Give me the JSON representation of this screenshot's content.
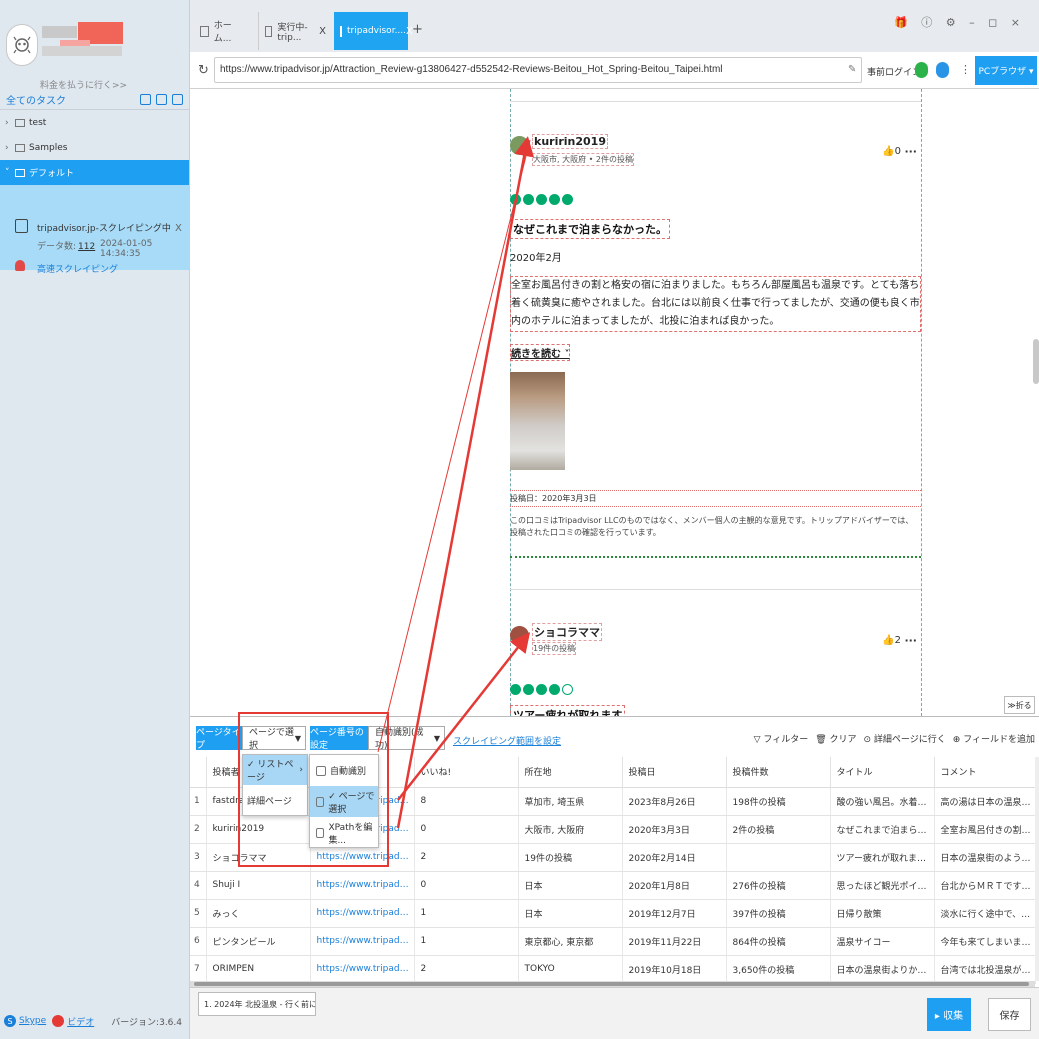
{
  "sidebar": {
    "pay_link": "料金を払うに行く>>",
    "tasks_header": "全てのタスク",
    "folders": [
      {
        "label": "test",
        "chev": "›"
      },
      {
        "label": "Samples",
        "chev": "›"
      },
      {
        "label": "デフォルト",
        "chev": "˅"
      }
    ],
    "task": {
      "name": "tripadvisor.jp-スクレイピング中",
      "close": "X",
      "count_label": "データ数:",
      "count": "112",
      "time": "2024-01-05 14:34:35",
      "mode": "高速スクレイピング"
    },
    "footer": {
      "skype": "Skype",
      "video": "ビデオ",
      "version": "バージョン:3.6.4"
    }
  },
  "tabs": [
    {
      "label": "ホーム...",
      "close": ""
    },
    {
      "label": "実行中-trip...",
      "close": "X"
    },
    {
      "label": "tripadvisor....",
      "close": "X"
    }
  ],
  "window_controls": "🎁 ⓘ ⚙ – ◻ ×",
  "address": {
    "url": "https://www.tripadvisor.jp/Attraction_Review-g13806427-d552542-Reviews-Beitou_Hot_Spring-Beitou_Taipei.html",
    "login": "事前ログイン",
    "mode_button": "PCブラウザ ▾"
  },
  "reviews": [
    {
      "name": "kuririn2019",
      "location": "大阪市, 大阪府 • 2件の投稿",
      "likes": "0",
      "rating": 5,
      "title": "なぜこれまで泊まらなかった。",
      "date": "2020年2月",
      "body": "全室お風呂付きの割と格安の宿に泊まりました。もちろん部屋風呂も温泉です。とても落ち着く硫黄臭に癒やされました。台北には以前良く仕事で行ってましたが、交通の便も良く市内のホテルに泊まってましたが、北投に泊まれば良かった。",
      "read_more": "続きを読む",
      "posted": "投稿日：2020年3月3日",
      "disclaimer": "この口コミはTripadvisor LLCのものではなく、メンバー個人の主観的な意見です。トリップアドバイザーでは、投稿された口コミの確認を行っています。"
    },
    {
      "name": "ショコラママ",
      "location": "19件の投稿",
      "likes": "2",
      "rating": 4,
      "title": "ツアー疲れが取れます"
    }
  ],
  "collapse_label": "≫折る",
  "panel": {
    "page_type_btn": "ページタイプ",
    "page_type_value": "ページで選択",
    "page_num_btn": "ページ番号の設定",
    "page_num_value": "自動識別(成功)",
    "scope_link": "スクレイピング範囲を設定",
    "actions": [
      "▽ フィルター",
      "🗑 クリア",
      "⊙ 詳細ページに行く",
      "⊕ フィールドを追加"
    ],
    "dropdown1": [
      {
        "label": "✓ リストページ",
        "sub": "›"
      },
      {
        "label": "詳細ページ",
        "sub": ""
      }
    ],
    "dropdown2": [
      "自動識別",
      "✓ ページで選択",
      "XPathを編集..."
    ],
    "columns": [
      "",
      "投稿者",
      "",
      "いいね!",
      "所在地",
      "投稿日",
      "投稿件数",
      "タイトル",
      "コメント"
    ],
    "rows": [
      [
        "1",
        "fastdravich",
        "https://www.tripadvisor.jp/Profil...",
        "8",
        "草加市, 埼玉県",
        "2023年8月26日",
        "198件の投稿",
        "酸の強い風呂。水着に注意。",
        "高の湯は日本の温泉地にある公..."
      ],
      [
        "2",
        "kuririn2019",
        "https://www.tripadvisor.jp/Profil...",
        "0",
        "大阪市, 大阪府",
        "2020年3月3日",
        "2件の投稿",
        "なぜこれまで泊まらなかった。",
        "全室お風呂付きの割と格安の宿..."
      ],
      [
        "3",
        "ショコラママ",
        "https://www.tripadvisor.jp/Profil...",
        "2",
        "19件の投稿",
        "2020年2月14日",
        "",
        "ツアー疲れが取れます。",
        "日本の温泉街のように、丘に沿..."
      ],
      [
        "4",
        "Shuji I",
        "https://www.tripadvisor.jp/Profil...",
        "0",
        "日本",
        "2020年1月8日",
        "276件の投稿",
        "思ったほど観光ポイントは少ない",
        "台北からＭＲＴですぐにこれる..."
      ],
      [
        "5",
        "みっく",
        "https://www.tripadvisor.jp/Profil...",
        "1",
        "日本",
        "2019年12月7日",
        "397件の投稿",
        "日帰り散策",
        "淡水に行く途中で、日帰り散策..."
      ],
      [
        "6",
        "ピンタンビール",
        "https://www.tripadvisor.jp/Profil...",
        "1",
        "東京都心, 東京都",
        "2019年11月22日",
        "864件の投稿",
        "温泉サイコー",
        "今年も来てしまいました。ここ..."
      ],
      [
        "7",
        "ORIMPEN",
        "https://www.tripadvisor.jp/Profil...",
        "2",
        "TOKYO",
        "2019年10月18日",
        "3,650件の投稿",
        "日本の温泉街よりかなりルール...",
        "台湾では北投温泉が有名との事..."
      ]
    ]
  },
  "status": {
    "task_tab": "1. 2024年 北投温泉 - 行く前に! 見...",
    "collect": "▸ 収集",
    "save": "保存"
  }
}
